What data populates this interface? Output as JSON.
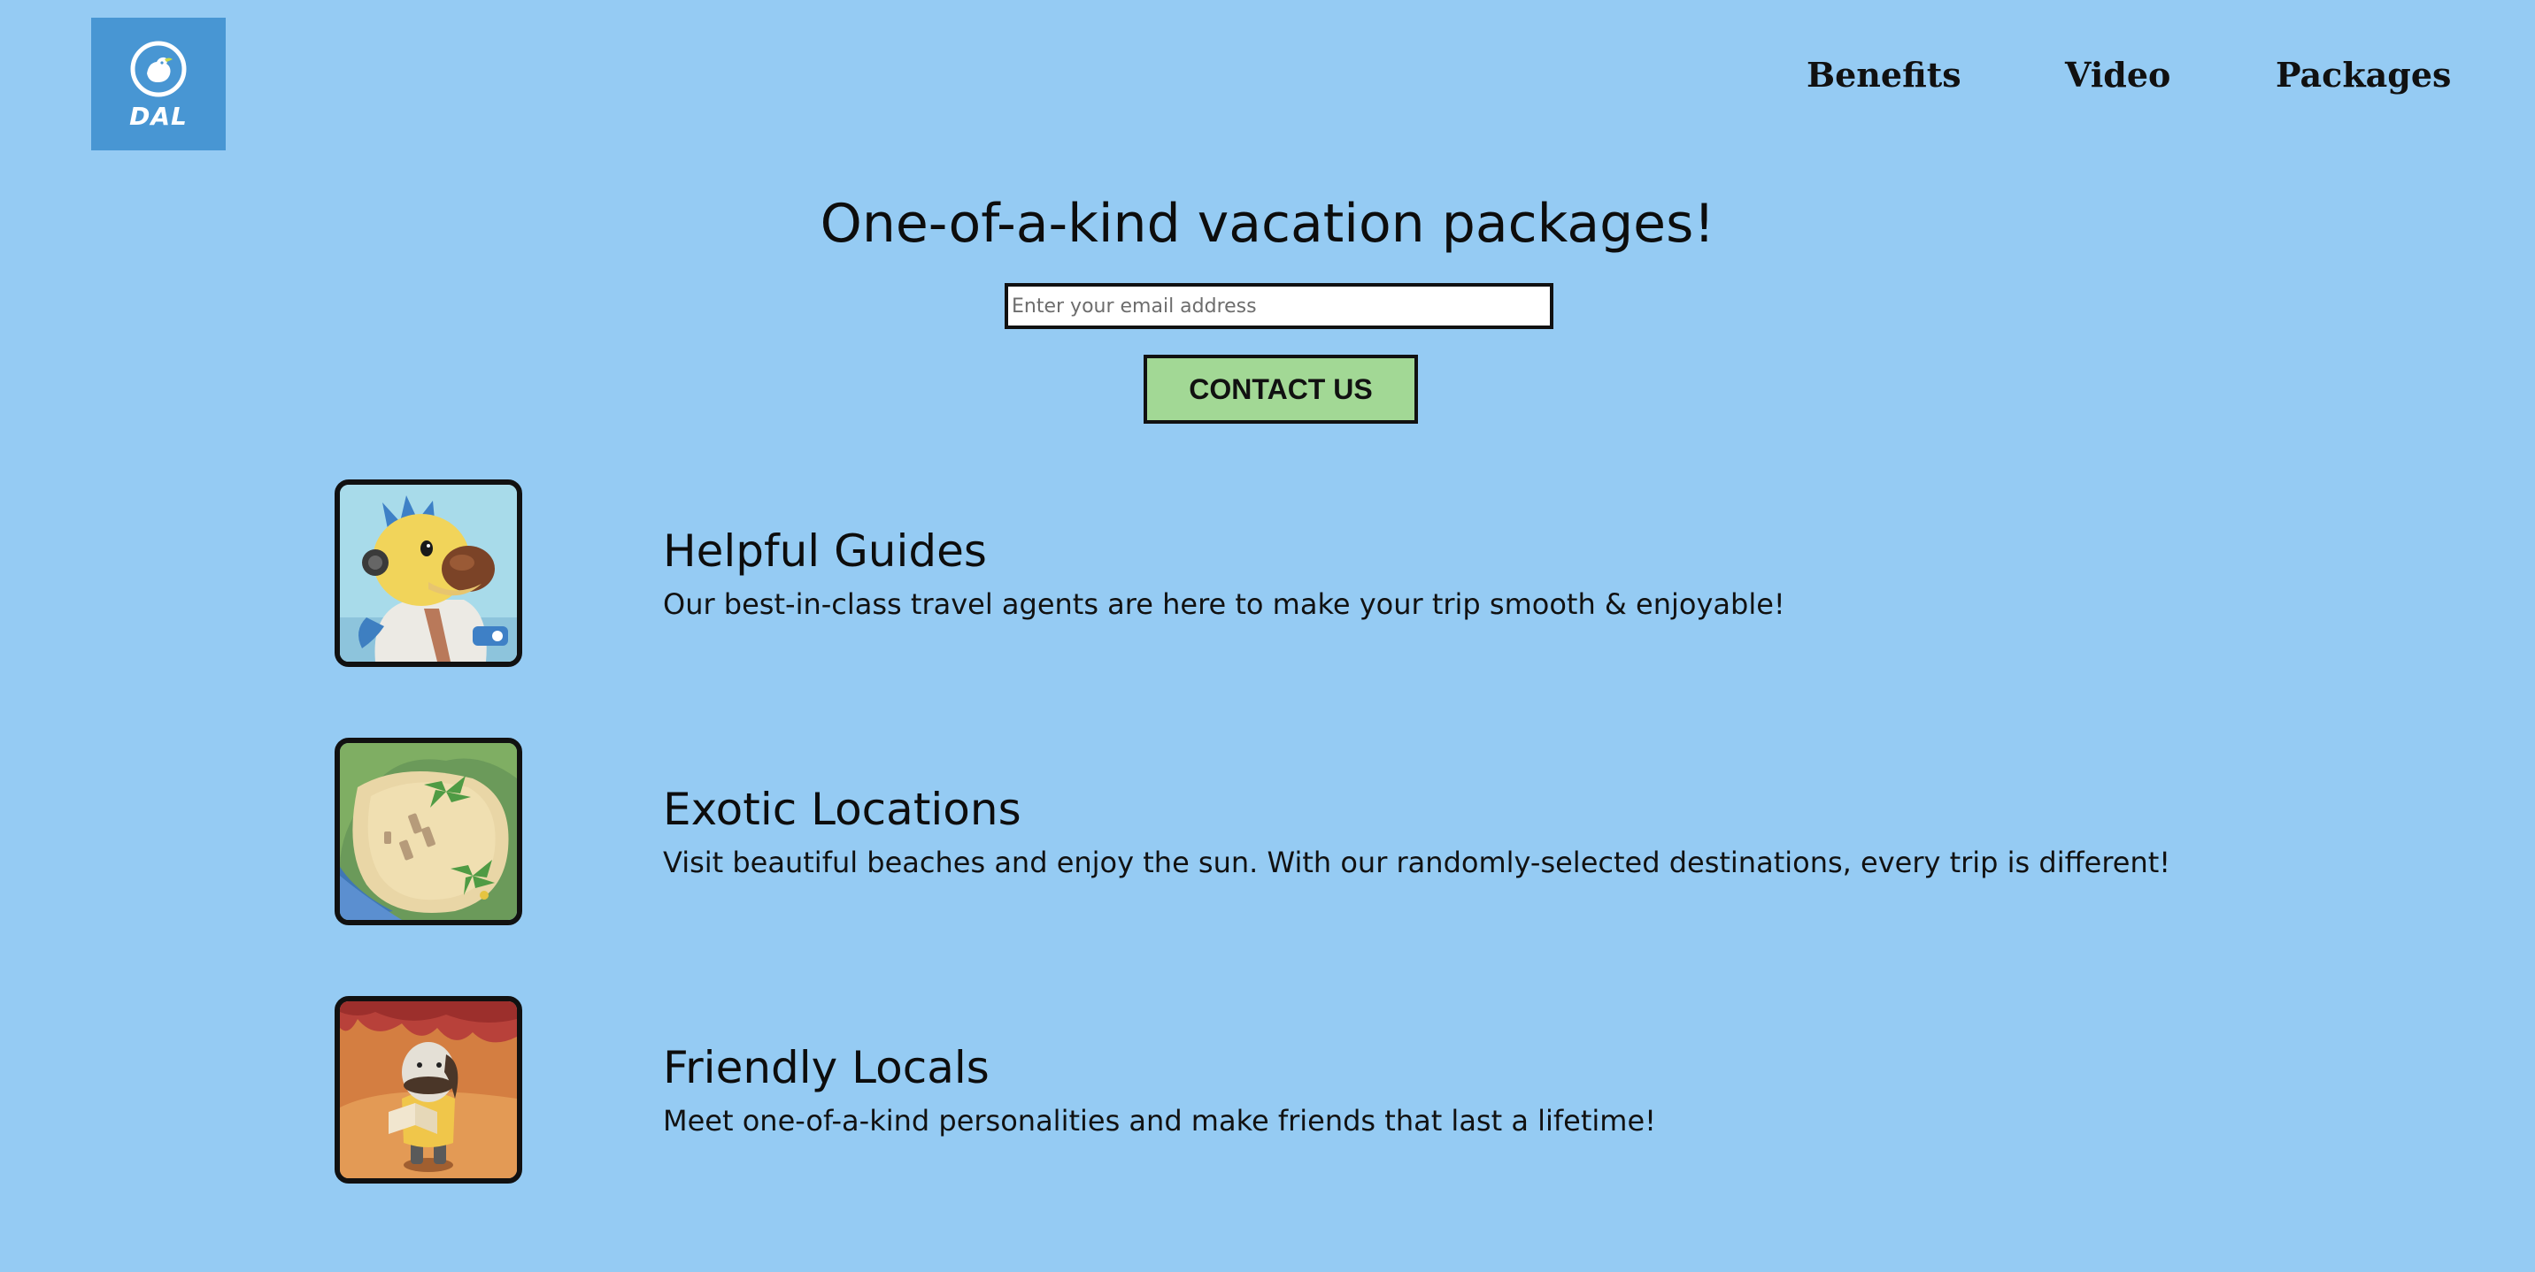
{
  "logo": {
    "text": "DAL",
    "icon": "dodo-bird-icon",
    "background_color": "#4896d3"
  },
  "nav": {
    "items": [
      {
        "label": "Benefits"
      },
      {
        "label": "Video"
      },
      {
        "label": "Packages"
      }
    ]
  },
  "hero": {
    "title": "One-of-a-kind vacation packages!",
    "email_placeholder": "Enter your email address",
    "email_value": "",
    "contact_label": "CONTACT US"
  },
  "features": [
    {
      "title": "Helpful Guides",
      "description": "Our best-in-class travel agents are here to make your trip smooth & enjoyable!",
      "image": "dodo-pilot-image"
    },
    {
      "title": "Exotic Locations",
      "description": "Visit beautiful beaches and enjoy the sun. With our randomly-selected destinations, every trip is different!",
      "image": "island-beach-image"
    },
    {
      "title": "Friendly Locals",
      "description": "Meet one-of-a-kind personalities and make friends that last a lifetime!",
      "image": "villager-character-image"
    }
  ],
  "colors": {
    "page_background": "#95cbf3",
    "button_background": "#a2d895",
    "border": "#111111"
  }
}
